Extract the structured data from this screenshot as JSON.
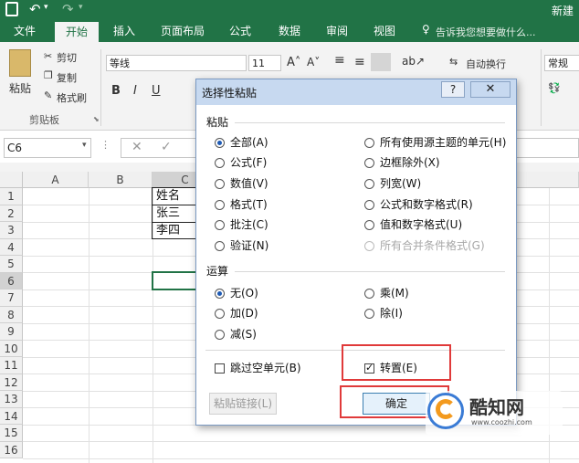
{
  "window": {
    "title_right": "新建"
  },
  "tabs": [
    "文件",
    "开始",
    "插入",
    "页面布局",
    "公式",
    "数据",
    "审阅",
    "视图"
  ],
  "tell_me": "告诉我您想要做什么...",
  "ribbon": {
    "paste": "粘贴",
    "cut": "剪切",
    "copy": "复制",
    "format_painter": "格式刷",
    "clipboard": "剪贴板",
    "font_name": "等线",
    "font_size": "11",
    "bold": "B",
    "italic": "I",
    "underline": "U",
    "wrap_text": "自动换行",
    "number_format": "常规"
  },
  "name_box": "C6",
  "columns": [
    "A",
    "B",
    "C"
  ],
  "rows": [
    "1",
    "2",
    "3",
    "4",
    "5",
    "6",
    "7",
    "8",
    "9",
    "10",
    "11",
    "12",
    "13",
    "14",
    "15",
    "16"
  ],
  "cells": {
    "c1": "姓名",
    "c2": "张三",
    "c3": "李四"
  },
  "dialog": {
    "title": "选择性粘贴",
    "help": "?",
    "paste_section": "粘贴",
    "paste_options_left": [
      "全部(A)",
      "公式(F)",
      "数值(V)",
      "格式(T)",
      "批注(C)",
      "验证(N)"
    ],
    "paste_options_right": [
      "所有使用源主题的单元(H)",
      "边框除外(X)",
      "列宽(W)",
      "公式和数字格式(R)",
      "值和数字格式(U)",
      "所有合并条件格式(G)"
    ],
    "operation_section": "运算",
    "operation_left": [
      "无(O)",
      "加(D)",
      "减(S)"
    ],
    "operation_right": [
      "乘(M)",
      "除(I)"
    ],
    "skip_blanks": "跳过空单元(B)",
    "transpose": "转置(E)",
    "paste_link": "粘贴链接(L)",
    "ok": "确定"
  },
  "watermark": {
    "brand": "酷知网",
    "url": "www.coozhi.com"
  },
  "colors": {
    "excel_green": "#217346",
    "highlight_red": "#e03a3a",
    "dialog_title": "#c7d9f0"
  }
}
